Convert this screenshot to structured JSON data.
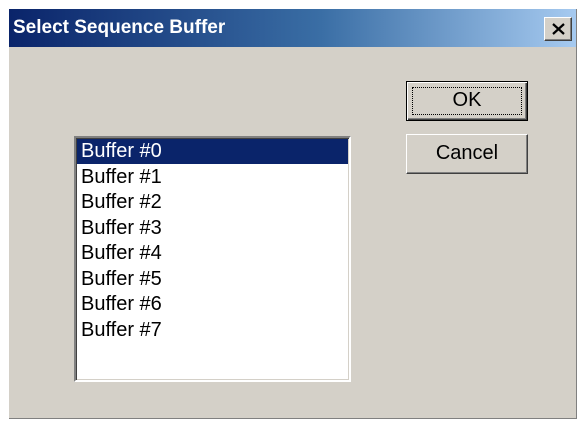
{
  "dialog": {
    "title": "Select Sequence Buffer",
    "buttons": {
      "ok_label": "OK",
      "cancel_label": "Cancel"
    },
    "buffers": [
      "Buffer #0",
      "Buffer #1",
      "Buffer #2",
      "Buffer #3",
      "Buffer #4",
      "Buffer #5",
      "Buffer #6",
      "Buffer #7"
    ],
    "selected_buffer": "Buffer #0"
  },
  "colors": {
    "titlebar_start": "#0a246a",
    "titlebar_end": "#a6caf0",
    "dialog_face": "#d4d0c8",
    "selection": "#0a246a"
  },
  "icons": {
    "close": "close-icon"
  }
}
